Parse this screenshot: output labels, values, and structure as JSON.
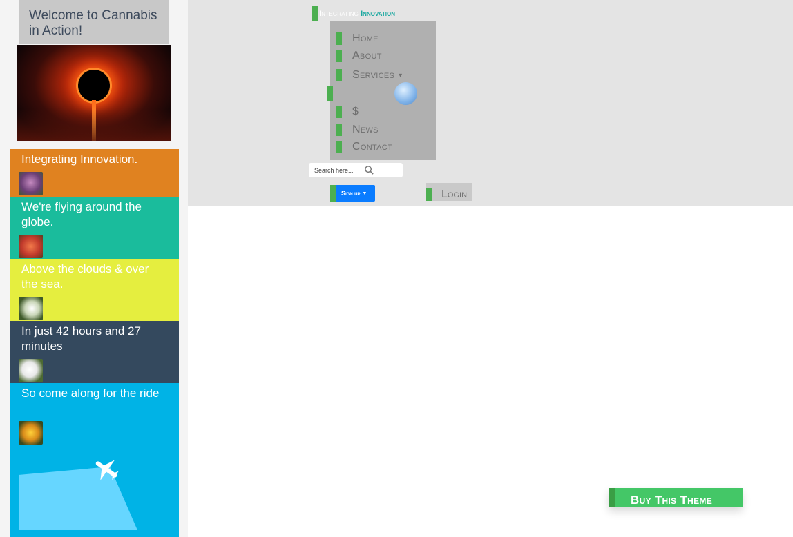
{
  "left_column": {
    "welcome_title": "Welcome to Cannabis in Action!",
    "slides": [
      {
        "caption": "Integrating Innovation.",
        "color": "#e08220"
      },
      {
        "caption": "We're flying around the globe.",
        "color": "#1abc9c"
      },
      {
        "caption": "Above the clouds & over the sea.",
        "color": "#e5ee3f"
      },
      {
        "caption": "In just 42 hours and 27 minutes",
        "color": "#34495e"
      },
      {
        "caption": "So come along for the ride",
        "color": "#00b3e6"
      }
    ]
  },
  "header": {
    "brand_part1": "Integrating",
    "brand_part2": "Innovation",
    "nav": [
      {
        "label": "Home"
      },
      {
        "label": "About"
      },
      {
        "label": "Services"
      },
      {
        "label": "$"
      },
      {
        "label": "News"
      },
      {
        "label": "Contact"
      }
    ],
    "search_placeholder": "Search here...",
    "signup_label": "Sign up",
    "login_label": "Login"
  },
  "cta": {
    "buy_label": "Buy This Theme"
  },
  "colors": {
    "accent_green": "#4caf50",
    "primary_blue": "#0a7cff",
    "buy_green": "#44c767"
  }
}
